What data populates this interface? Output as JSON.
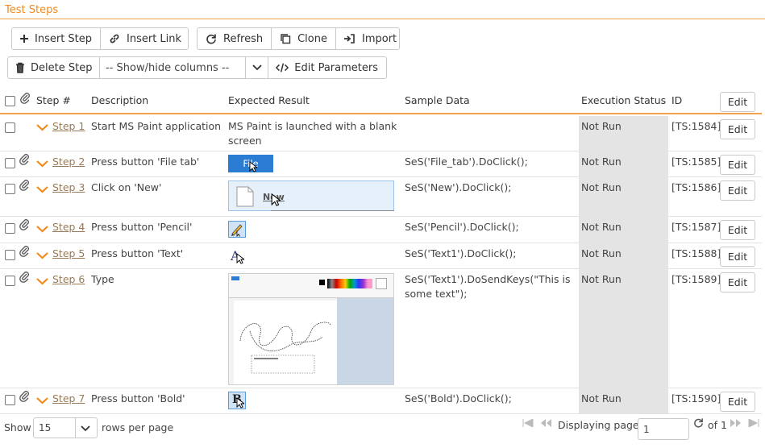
{
  "section": {
    "title": "Test Steps"
  },
  "toolbar": {
    "insert_step": "Insert Step",
    "insert_link": "Insert Link",
    "refresh": "Refresh",
    "clone": "Clone",
    "import": "Import",
    "delete_step": "Delete Step",
    "columns_select": "-- Show/hide columns --",
    "edit_parameters": "Edit Parameters"
  },
  "columns": {
    "step": "Step #",
    "description": "Description",
    "expected": "Expected Result",
    "sample": "Sample Data",
    "execution": "Execution Status",
    "id": "ID",
    "edit": "Edit"
  },
  "rows": [
    {
      "step": "Step 1",
      "description": "Start MS Paint application",
      "expected": "MS Paint is launched with a blank screen",
      "sample": "",
      "status": "Not Run",
      "id": "[TS:1584]",
      "edit": "Edit",
      "attachment": false
    },
    {
      "step": "Step 2",
      "description": "Press button 'File tab'",
      "expected_img": "File",
      "sample": "SeS('File_tab').DoClick();",
      "status": "Not Run",
      "id": "[TS:1585]",
      "edit": "Edit",
      "attachment": true
    },
    {
      "step": "Step 3",
      "description": "Click on 'New'",
      "expected_img": "New",
      "sample": "SeS('New').DoClick();",
      "status": "Not Run",
      "id": "[TS:1586]",
      "edit": "Edit",
      "attachment": true
    },
    {
      "step": "Step 4",
      "description": "Press button 'Pencil'",
      "sample": "SeS('Pencil').DoClick();",
      "status": "Not Run",
      "id": "[TS:1587]",
      "edit": "Edit",
      "attachment": true
    },
    {
      "step": "Step 5",
      "description": "Press button 'Text'",
      "expected_img": "A",
      "sample": "SeS('Text1').DoClick();",
      "status": "Not Run",
      "id": "[TS:1588]",
      "edit": "Edit",
      "attachment": true
    },
    {
      "step": "Step 6",
      "description": "Type",
      "sample_line1": "SeS('Text1').DoSendKeys(\"This is",
      "sample_line2": "some text\");",
      "status": "Not Run",
      "id": "[TS:1589]",
      "edit": "Edit",
      "attachment": true
    },
    {
      "step": "Step 7",
      "description": "Press button 'Bold'",
      "expected_img": "B",
      "sample": "SeS('Bold').DoClick();",
      "status": "Not Run",
      "id": "[TS:1590]",
      "edit": "Edit",
      "attachment": true
    }
  ],
  "footer": {
    "show": "Show",
    "rows_value": "15",
    "rows_per_page": "rows per page",
    "displaying_page": "Displaying page",
    "page_value": "1",
    "of_total": "of 1"
  },
  "colors": {
    "accent": "#f08a1c",
    "link": "#9a7a55",
    "status_bg": "#e4e4e4",
    "file_btn": "#2b7cd3"
  }
}
